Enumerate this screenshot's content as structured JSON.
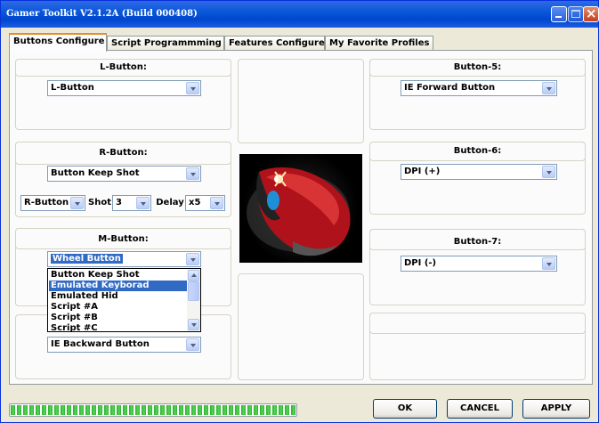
{
  "window": {
    "title": "Gamer Toolkit V2.1.2A (Build 000408)"
  },
  "tabs": [
    {
      "label": "Buttons Configure"
    },
    {
      "label": "Script Programmming"
    },
    {
      "label": "Features Configure"
    },
    {
      "label": "My Favorite Profiles"
    }
  ],
  "left": {
    "l_button": {
      "label": "L-Button:",
      "value": "L-Button"
    },
    "r_button": {
      "label": "R-Button:",
      "value": "Button Keep Shot",
      "source_value": "R-Button",
      "shot_label": "Shot",
      "shot_value": "3",
      "delay_label": "Delay",
      "delay_value": "x5"
    },
    "m_button": {
      "label": "M-Button:",
      "value": "Wheel Button",
      "dropdown_options": [
        "Button Keep Shot",
        "Emulated Keyborad",
        "Emulated Hid",
        "Script #A",
        "Script #B",
        "Script #C"
      ],
      "highlighted_option": "Emulated Keyborad"
    },
    "button_4": {
      "value": "IE Backward Button"
    }
  },
  "right": {
    "button_5": {
      "label": "Button-5:",
      "value": "IE Forward Button"
    },
    "button_6": {
      "label": "Button-6:",
      "value": "DPI (+)"
    },
    "button_7": {
      "label": "Button-7:",
      "value": "DPI (-)"
    }
  },
  "footer": {
    "progress_fraction": 1.0,
    "ok_label": "OK",
    "cancel_label": "CANCEL",
    "apply_label": "APPLY"
  },
  "icons": [
    "minimize-icon",
    "maximize-icon",
    "close-icon",
    "mouse-image"
  ]
}
